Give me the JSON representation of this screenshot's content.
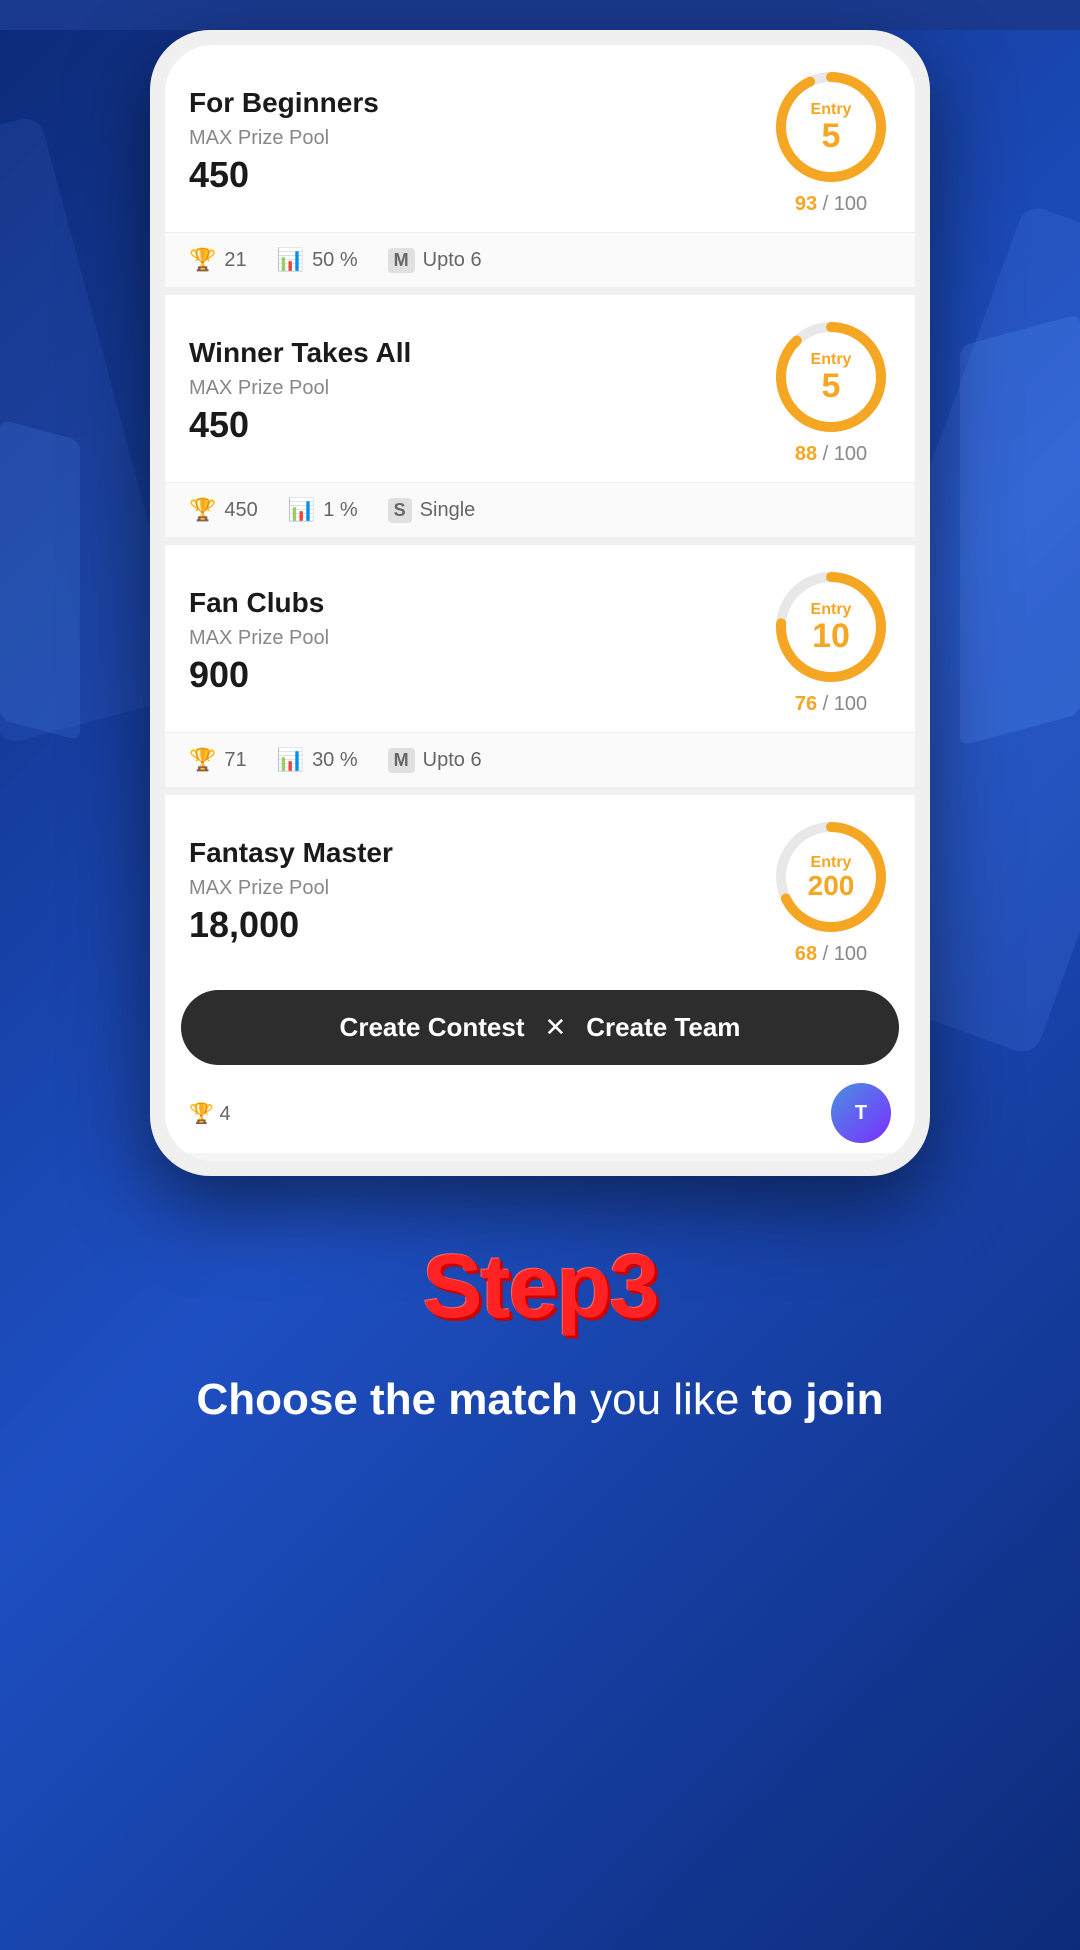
{
  "background": {
    "color": "#1a3a8f"
  },
  "contests": [
    {
      "id": "for-beginners",
      "title": "For Beginners",
      "prize_label": "MAX Prize Pool",
      "prize_value": "450",
      "entry_cost": "5",
      "slots_filled": "93",
      "slots_total": "100",
      "progress_pct": 93,
      "stats": [
        {
          "icon": "trophy",
          "value": "21"
        },
        {
          "icon": "chart",
          "value": "50 %"
        },
        {
          "icon": "M",
          "value": "Upto 6"
        }
      ]
    },
    {
      "id": "winner-takes-all",
      "title": "Winner Takes All",
      "prize_label": "MAX Prize Pool",
      "prize_value": "450",
      "entry_cost": "5",
      "slots_filled": "88",
      "slots_total": "100",
      "progress_pct": 88,
      "stats": [
        {
          "icon": "trophy",
          "value": "450"
        },
        {
          "icon": "chart",
          "value": "1 %"
        },
        {
          "icon": "S",
          "value": "Single"
        }
      ]
    },
    {
      "id": "fan-clubs",
      "title": "Fan Clubs",
      "prize_label": "MAX Prize Pool",
      "prize_value": "900",
      "entry_cost": "10",
      "slots_filled": "76",
      "slots_total": "100",
      "progress_pct": 76,
      "stats": [
        {
          "icon": "trophy",
          "value": "71"
        },
        {
          "icon": "chart",
          "value": "30 %"
        },
        {
          "icon": "M",
          "value": "Upto 6"
        }
      ]
    },
    {
      "id": "fantasy-master",
      "title": "Fantasy Master",
      "prize_label": "MAX Prize Pool",
      "prize_value": "18,000",
      "entry_cost": "200",
      "slots_filled": "68",
      "slots_total": "100",
      "progress_pct": 68,
      "stats": [
        {
          "icon": "trophy",
          "value": "4"
        }
      ]
    }
  ],
  "action_bar": {
    "create_contest": "Create Contest",
    "divider": "✕",
    "create_team": "Create Team"
  },
  "step": {
    "title": "Step3",
    "subtitle_bold1": "Choose the match",
    "subtitle_normal": " you like ",
    "subtitle_bold2": "to join"
  },
  "icons": {
    "trophy": "🏆",
    "chart": "📊",
    "M": "M",
    "S": "S"
  }
}
